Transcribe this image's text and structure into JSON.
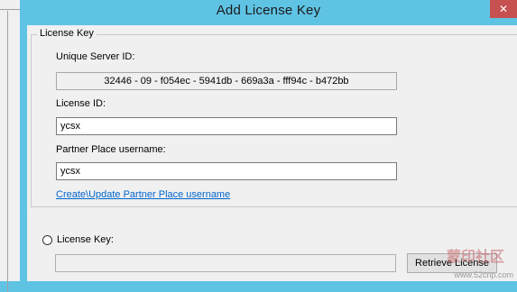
{
  "window": {
    "title": "Add License Key",
    "close_glyph": "✕"
  },
  "group": {
    "label": "License Key"
  },
  "server_id": {
    "label": "Unique Server ID:",
    "value": "32446 - 09 - f054ec - 5941db - 669a3a - fff94c - b472bb"
  },
  "license_id": {
    "label": "License ID:",
    "value": "ycsx"
  },
  "partner": {
    "label": "Partner Place username:",
    "value": "ycsx",
    "link": "Create\\Update Partner Place username"
  },
  "license_key": {
    "label": "License Key:",
    "value": ""
  },
  "buttons": {
    "retrieve": "Retrieve License"
  },
  "watermark": {
    "text": "蒙印社区",
    "url": "www.52cnp.com"
  },
  "colors": {
    "titlebar": "#5fc3e4",
    "link": "#0066cc"
  }
}
